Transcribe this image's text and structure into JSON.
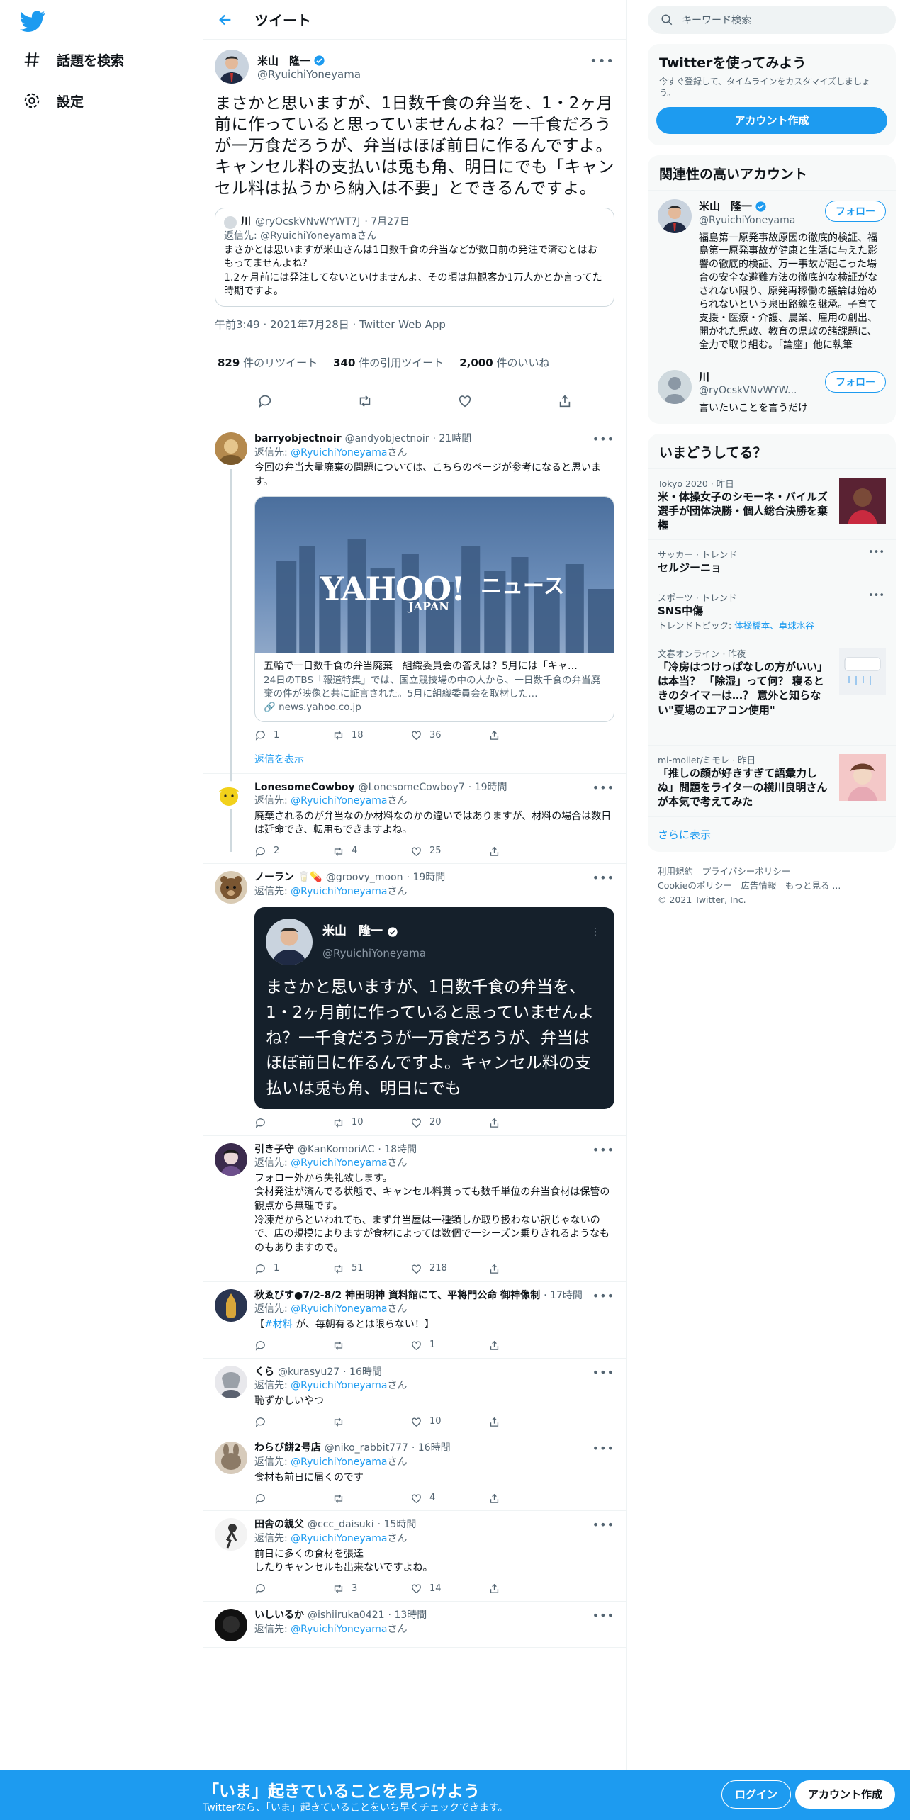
{
  "nav": {
    "explore": "話題を検索",
    "settings": "設定"
  },
  "header": {
    "title": "ツイート"
  },
  "tweet": {
    "name": "米山　隆一",
    "handle": "@RyuichiYoneyama",
    "text": "まさかと思いますが、1日数千食の弁当を、1・2ヶ月前に作っていると思っていませんよね？一千食だろうが一万食だろうが、弁当はほぼ前日に作るんですよ。キャンセル料の支払いは兎も角、明日にでも「キャンセル料は払うから納入は不要」とできるんですよ。",
    "quote": {
      "name": "川",
      "handle": "@ryOcskVNvWYWT7J",
      "date": "· 7月27日",
      "reply_to": "返信先: @RyuichiYoneyamaさん",
      "text": "まさかとは思いますが米山さんは1日数千食の弁当などが数日前の発注で済むとはおもってませんよね？\n1.2ヶ月前には発注してないといけませんよ、その頃は無観客か1万人かとか言ってた時期ですよ。"
    },
    "timestamp": "午前3:49 · 2021年7月28日 · Twitter Web App",
    "stats": {
      "retweets_num": "829",
      "retweets_label": "件のリツイート",
      "quotes_num": "340",
      "quotes_label": "件の引用ツイート",
      "likes_num": "2,000",
      "likes_label": "件のいいね"
    }
  },
  "replies": [
    {
      "name": "barryobjectnoir",
      "handle": "@andyobjectnoir",
      "time": "· 21時間",
      "reply_prefix": "返信先:",
      "reply_handle": "@RyuichiYoneyama",
      "reply_suffix": "さん",
      "text": "今回の弁当大量廃棄の問題については、こちらのページが参考になると思います。",
      "card": {
        "logo": "YAHOO!",
        "logo_sub": "JAPAN",
        "logo_news": "ニュース",
        "title": "五輪で一日数千食の弁当廃棄　組織委員会の答えは？5月には「キャ…",
        "desc": "24日のTBS「報道特集」では、国立競技場の中の人から、一日数千食の弁当廃棄の件が映像と共に証言された。5月に組織委員会を取材した…",
        "domain": "news.yahoo.co.jp"
      },
      "replies": "1",
      "retweets": "18",
      "likes": "36",
      "show_replies": "返信を表示"
    },
    {
      "name": "LonesomeCowboy",
      "handle": "@LonesomeCowboy7",
      "time": "· 19時間",
      "reply_prefix": "返信先:",
      "reply_handle": "@RyuichiYoneyama",
      "reply_suffix": "さん",
      "text": "廃棄されるのが弁当なのか材料なのかの違いではありますが、材料の場合は数日は延命でき、転用もできますよね。",
      "replies": "2",
      "retweets": "4",
      "likes": "25"
    },
    {
      "name": "ノーラン",
      "handle": "@groovy_moon",
      "time": "· 19時間",
      "reply_prefix": "返信先:",
      "reply_handle": "@RyuichiYoneyama",
      "reply_suffix": "さん",
      "embed": {
        "name": "米山　隆一",
        "handle": "@RyuichiYoneyama",
        "text": "まさかと思いますが、1日数千食の弁当を、1・2ヶ月前に作っていると思っていませんよね？一千食だろうが一万食だろうが、弁当はほぼ前日に作るんですよ。キャンセル料の支払いは兎も角、明日にでも"
      },
      "replies": "",
      "retweets": "10",
      "likes": "20"
    },
    {
      "name": "引き子守",
      "handle": "@KanKomoriAC",
      "time": "· 18時間",
      "reply_prefix": "返信先:",
      "reply_handle": "@RyuichiYoneyama",
      "reply_suffix": "さん",
      "text": "フォロー外から失礼致します。\n食材発注が済んでる状態で、キャンセル料貰っても数千単位の弁当食材は保管の観点から無理です。\n冷凍だからといわれても、まず弁当屋は一種類しか取り扱わない訳じゃないので、店の規模によりますが食材によっては数個で一シーズン乗りきれるようなものもありますので。",
      "replies": "1",
      "retweets": "51",
      "likes": "218"
    },
    {
      "name": "秋ゑびす●7/2-8/2 神田明神 資料館にて、平将門公命 御神像制",
      "handle": "",
      "time": "· 17時間",
      "reply_prefix": "返信先:",
      "reply_handle": "@RyuichiYoneyama",
      "reply_suffix": "さん",
      "text_pre": "【",
      "text_tag": "#材料",
      "text_post": " が、毎朝有るとは限らない！】",
      "replies": "",
      "retweets": "",
      "likes": "1"
    },
    {
      "name": "くら",
      "handle": "@kurasyu27",
      "time": "· 16時間",
      "reply_prefix": "返信先:",
      "reply_handle": "@RyuichiYoneyama",
      "reply_suffix": "さん",
      "text": "恥ずかしいやつ",
      "replies": "",
      "retweets": "",
      "likes": "10"
    },
    {
      "name": "わらび餅2号店",
      "handle": "@niko_rabbit777",
      "time": "· 16時間",
      "reply_prefix": "返信先:",
      "reply_handle": "@RyuichiYoneyama",
      "reply_suffix": "さん",
      "text": "食材も前日に届くのです",
      "replies": "",
      "retweets": "",
      "likes": "4"
    },
    {
      "name": "田舎の親父",
      "handle": "@ccc_daisuki",
      "time": "· 15時間",
      "reply_prefix": "返信先:",
      "reply_handle": "@RyuichiYoneyama",
      "reply_suffix": "さん",
      "text": "前日に多くの食材を張達\nしたりキャンセルも出来ないですよね。",
      "replies": "",
      "retweets": "3",
      "likes": "14"
    },
    {
      "name": "いしいるか",
      "handle": "@ishiiruka0421",
      "time": "· 13時間",
      "reply_prefix": "返信先:",
      "reply_handle": "@RyuichiYoneyama",
      "reply_suffix": "さん"
    }
  ],
  "sidebar": {
    "search_placeholder": "キーワード検索",
    "join": {
      "title": "Twitterを使ってみよう",
      "text": "今すぐ登録して、タイムラインをカスタマイズしましょう。",
      "button": "アカウント作成"
    },
    "related": {
      "title": "関連性の高いアカウント",
      "accounts": [
        {
          "name": "米山　隆一",
          "handle": "@RyuichiYoneyama",
          "follow": "フォロー",
          "bio": "福島第一原発事故原因の徹底的検証、福島第一原発事故が健康と生活に与えた影響の徹底的検証、万一事故が起こった場合の安全な避難方法の徹底的な検証がなされない限り、原発再稼働の議論は始められないという泉田路線を継承。子育て支援・医療・介護、農業、雇用の創出、開かれた県政、教育の県政の諸課題に、全力で取り組む。「論座」他に執筆"
        },
        {
          "name": "川",
          "handle": "@ryOcskVNvWYW...",
          "follow": "フォロー",
          "bio": "言いたいことを言うだけ"
        }
      ]
    },
    "trends": {
      "title": "いまどうしてる？",
      "items": [
        {
          "context": "Tokyo 2020 · 昨日",
          "title": "米・体操女子のシモーネ・バイルズ選手が団体決勝・個人総合決勝を棄権",
          "thumb": true
        },
        {
          "context": "サッカー · トレンド",
          "title": "セルジーニョ"
        },
        {
          "context": "スポーツ · トレンド",
          "title": "SNS中傷",
          "sub_prefix": "トレンドトピック: ",
          "sub_links": "体操橋本、卓球水谷"
        },
        {
          "context": "文春オンライン · 昨夜",
          "title": "「冷房はつけっぱなしの方がいい」は本当？ 「除湿」って何？ 寝るときのタイマーは…？ 意外と知らない\"夏場のエアコン使用\"",
          "thumb": true
        },
        {
          "context": "mi-mollet/ミモレ · 昨日",
          "title": "「推しの顔が好きすぎて語彙力しぬ」問題をライターの横川良明さんが本気で考えてみた",
          "thumb": true
        }
      ],
      "show_more": "さらに表示"
    },
    "footer": {
      "links1": "利用規約　プライバシーポリシー",
      "links2": "Cookieのポリシー　広告情報　もっと見る ...",
      "copy": "© 2021 Twitter, Inc."
    }
  },
  "bottom": {
    "title": "「いま」起きていることを見つけよう",
    "subtitle": "Twitterなら、「いま」起きていることをいち早くチェックできます。",
    "login": "ログイン",
    "signup": "アカウント作成"
  },
  "colors": {
    "accent": "#1d9bf0",
    "dark_embed": "#15202b"
  }
}
